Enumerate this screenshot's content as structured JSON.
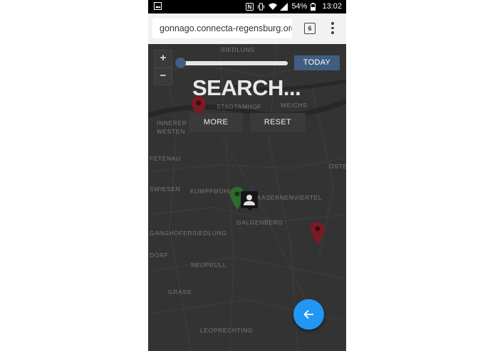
{
  "statusbar": {
    "battery": "54%",
    "time": "13:02"
  },
  "browser": {
    "url": "gonnago.connecta-regensburg.org",
    "tab_count": "6"
  },
  "map": {
    "zoom_in": "+",
    "zoom_out": "−",
    "places": {
      "p1": "SIEDLUNG",
      "p2": "STADTAMHOF",
      "p3": "WEICHS",
      "p4": "INNERER",
      "p5": "WESTEN",
      "p6": "FETENAU",
      "p7": "OSTE",
      "p8": "SWIESEN",
      "p9": "KUMPFMÜHL",
      "p10": "KASERNENVIERTEL",
      "p11": "GALGENBERG",
      "p12": "GANGHOFERSIEDLUNG",
      "p13": "DORF",
      "p14": "NEUPRÜLL",
      "p15": "GRASS",
      "p16": "LEOPRECHTING"
    }
  },
  "controls": {
    "today_label": "TODAY",
    "search_title": "SEARCH...",
    "more_label": "MORE",
    "reset_label": "RESET",
    "slider_value": 0
  },
  "colors": {
    "accent": "#3f5e80",
    "fab": "#2196f3",
    "pin_red": "#7a1a22",
    "pin_green": "#2e6b2e"
  }
}
